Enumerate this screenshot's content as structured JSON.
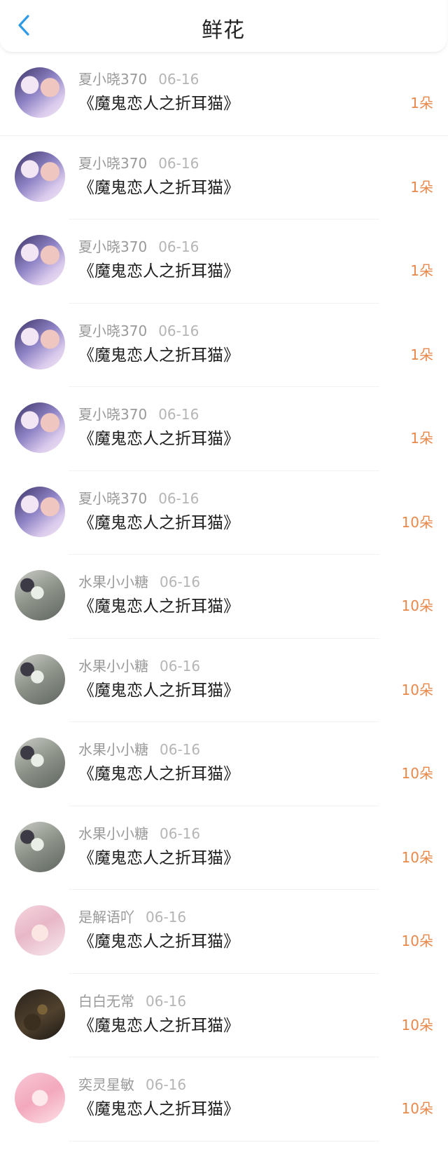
{
  "header": {
    "title": "鲜花",
    "back_icon": "chevron-left-icon",
    "accent_color": "#2f9be5"
  },
  "colors": {
    "amount": "#e8884a",
    "username": "#9a9a9a",
    "date": "#b5b5b5"
  },
  "rows": [
    {
      "user": "夏小晓370",
      "date": "06-16",
      "book": "《魔鬼恋人之折耳猫》",
      "amount": "1朵",
      "avatar": "a"
    },
    {
      "user": "夏小晓370",
      "date": "06-16",
      "book": "《魔鬼恋人之折耳猫》",
      "amount": "1朵",
      "avatar": "a"
    },
    {
      "user": "夏小晓370",
      "date": "06-16",
      "book": "《魔鬼恋人之折耳猫》",
      "amount": "1朵",
      "avatar": "a"
    },
    {
      "user": "夏小晓370",
      "date": "06-16",
      "book": "《魔鬼恋人之折耳猫》",
      "amount": "1朵",
      "avatar": "a"
    },
    {
      "user": "夏小晓370",
      "date": "06-16",
      "book": "《魔鬼恋人之折耳猫》",
      "amount": "1朵",
      "avatar": "a"
    },
    {
      "user": "夏小晓370",
      "date": "06-16",
      "book": "《魔鬼恋人之折耳猫》",
      "amount": "10朵",
      "avatar": "a"
    },
    {
      "user": "水果小小糖",
      "date": "06-16",
      "book": "《魔鬼恋人之折耳猫》",
      "amount": "10朵",
      "avatar": "b"
    },
    {
      "user": "水果小小糖",
      "date": "06-16",
      "book": "《魔鬼恋人之折耳猫》",
      "amount": "10朵",
      "avatar": "b"
    },
    {
      "user": "水果小小糖",
      "date": "06-16",
      "book": "《魔鬼恋人之折耳猫》",
      "amount": "10朵",
      "avatar": "b"
    },
    {
      "user": "水果小小糖",
      "date": "06-16",
      "book": "《魔鬼恋人之折耳猫》",
      "amount": "10朵",
      "avatar": "b"
    },
    {
      "user": "是解语吖",
      "date": "06-16",
      "book": "《魔鬼恋人之折耳猫》",
      "amount": "10朵",
      "avatar": "c"
    },
    {
      "user": "白白无常",
      "date": "06-16",
      "book": "《魔鬼恋人之折耳猫》",
      "amount": "10朵",
      "avatar": "d"
    },
    {
      "user": "奕灵星敏",
      "date": "06-16",
      "book": "《魔鬼恋人之折耳猫》",
      "amount": "10朵",
      "avatar": "e"
    }
  ]
}
